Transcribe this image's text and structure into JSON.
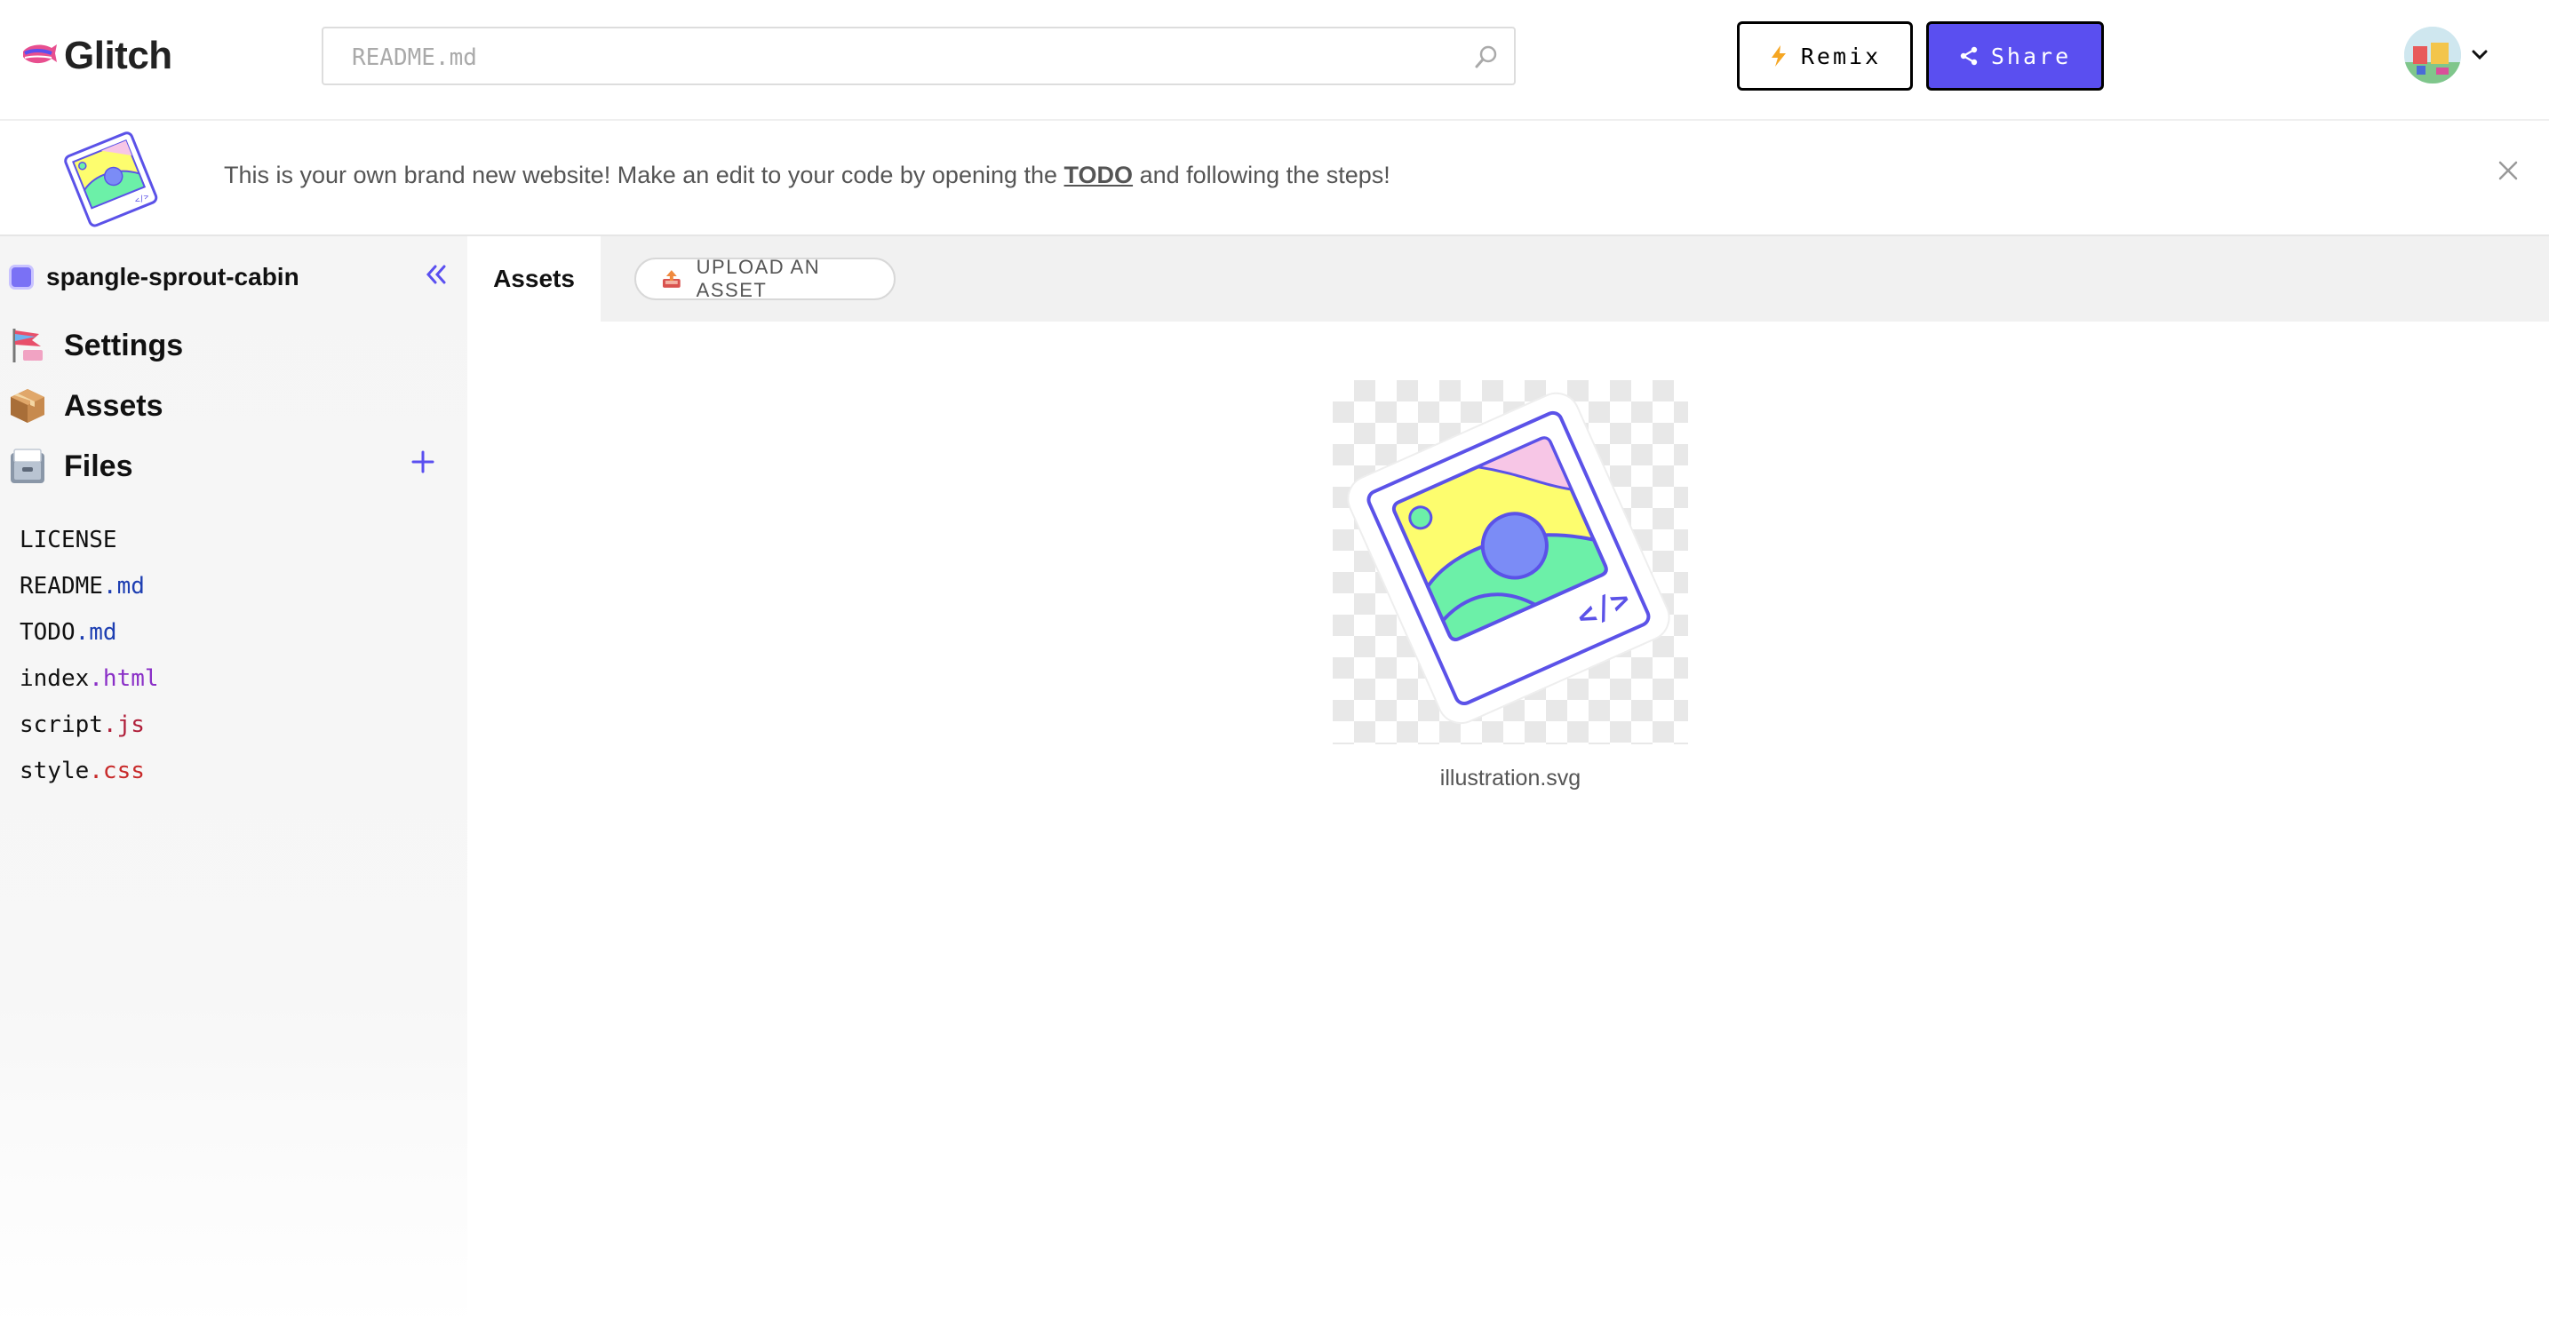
{
  "header": {
    "app_name": "Glitch",
    "search_placeholder": "README.md",
    "remix_label": "Remix",
    "share_label": "Share"
  },
  "banner": {
    "text_before": "This is your own brand new website! Make an edit to your code by opening the ",
    "link_text": "TODO",
    "text_after": " and following the steps!"
  },
  "sidebar": {
    "project_name": "spangle-sprout-cabin",
    "nav": [
      {
        "label": "Settings",
        "icon": "settings-flag-icon"
      },
      {
        "label": "Assets",
        "icon": "box-icon"
      },
      {
        "label": "Files",
        "icon": "file-cabinet-icon"
      }
    ],
    "files": [
      {
        "name": "LICENSE",
        "ext": "",
        "ext_color": "#111111"
      },
      {
        "name": "README",
        "ext": ".md",
        "ext_color": "#1e3fb2"
      },
      {
        "name": "TODO",
        "ext": ".md",
        "ext_color": "#1e3fb2"
      },
      {
        "name": "index",
        "ext": ".html",
        "ext_color": "#8a2fc7"
      },
      {
        "name": "script",
        "ext": ".js",
        "ext_color": "#b01f3a"
      },
      {
        "name": "style",
        "ext": ".css",
        "ext_color": "#c82b2b"
      }
    ]
  },
  "main": {
    "tab_label": "Assets",
    "upload_label": "UPLOAD AN ASSET",
    "assets": [
      {
        "name": "illustration.svg"
      }
    ]
  },
  "colors": {
    "accent": "#5a4ff0",
    "illustration_blue": "#5b52e8",
    "illustration_yellow": "#fdfd6e",
    "illustration_green": "#6cf0a8",
    "illustration_pink": "#f7c6e6",
    "illustration_circle": "#7b8cf6"
  }
}
